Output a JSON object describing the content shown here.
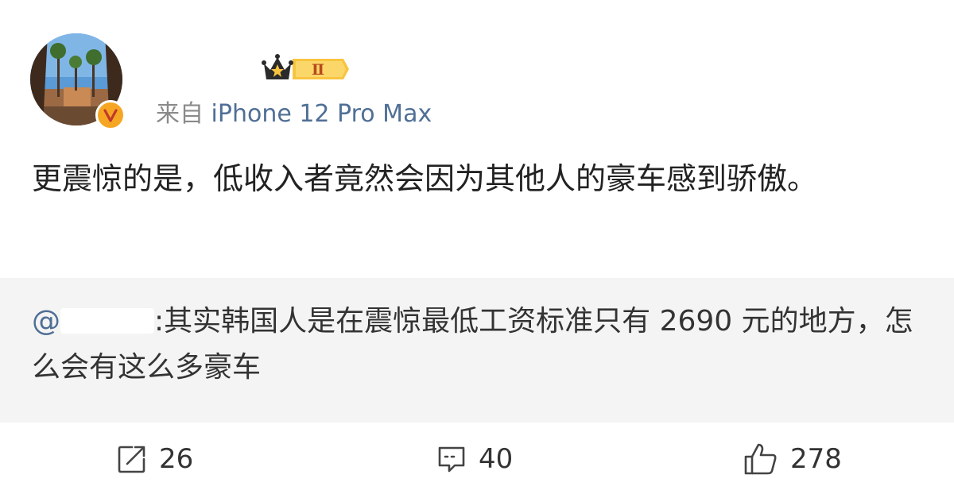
{
  "post": {
    "level_badge": "Ⅱ",
    "source_prefix": "来自",
    "source_device": "iPhone 12 Pro Max",
    "text": "更震惊的是，低收入者竟然会因为其他人的豪车感到骄傲。"
  },
  "quote": {
    "mention_prefix": "@",
    "text": ":其实韩国人是在震惊最低工资标准只有 2690 元的地方，怎么会有这么多豪车"
  },
  "actions": {
    "repost_count": "26",
    "comment_count": "40",
    "like_count": "278"
  },
  "colors": {
    "link": "#4f6f96",
    "verified": "#f6a623",
    "quote_background": "#f4f4f4"
  }
}
